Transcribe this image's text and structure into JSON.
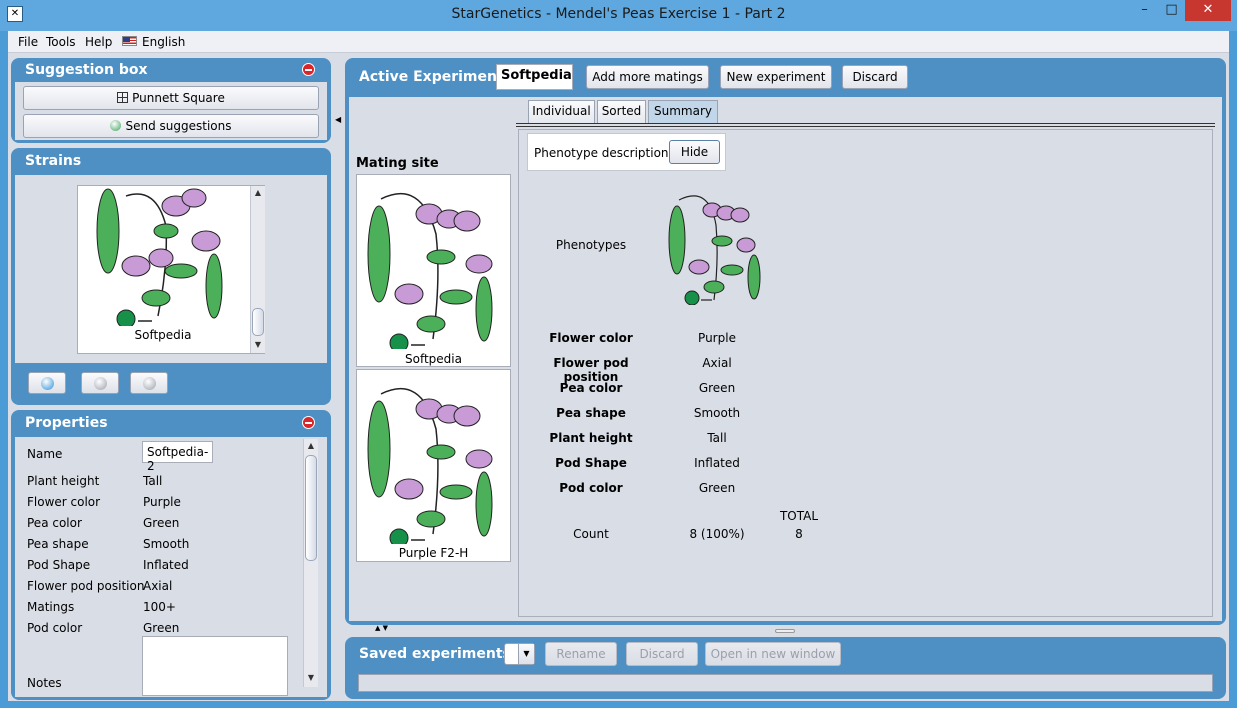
{
  "window": {
    "title": "StarGenetics - Mendel's Peas Exercise 1 - Part 2",
    "minimize_glyph": "–",
    "maximize_glyph": "□",
    "close_glyph": "✕"
  },
  "menu": {
    "file": "File",
    "tools": "Tools",
    "help": "Help",
    "language": "English"
  },
  "suggestion_box": {
    "title": "Suggestion box",
    "punnett_label": "Punnett Square",
    "send_label": "Send suggestions"
  },
  "strains": {
    "title": "Strains",
    "strain_caption": "Softpedia"
  },
  "properties": {
    "title": "Properties",
    "name_label": "Name",
    "name_value": "Softpedia-2",
    "rows": [
      {
        "label": "Plant height",
        "value": "Tall"
      },
      {
        "label": "Flower color",
        "value": "Purple"
      },
      {
        "label": "Pea color",
        "value": "Green"
      },
      {
        "label": "Pea shape",
        "value": "Smooth"
      },
      {
        "label": "Pod Shape",
        "value": "Inflated"
      },
      {
        "label": "Flower pod position",
        "value": "Axial"
      },
      {
        "label": "Matings",
        "value": "100+"
      },
      {
        "label": "Pod color",
        "value": "Green"
      }
    ],
    "notes_label": "Notes"
  },
  "active_experiment": {
    "title": "Active Experiment",
    "name_value": "Softpedia",
    "add_more_label": "Add more matings",
    "new_experiment_label": "New experiment",
    "discard_label": "Discard",
    "mating_site_label": "Mating site",
    "parent1_caption": "Softpedia",
    "parent2_caption": "Purple F2-H",
    "tabs": [
      "Individual",
      "Sorted",
      "Summary"
    ],
    "selected_tab": "Summary",
    "phenotype_description_label": "Phenotype description:",
    "hide_label": "Hide",
    "phenotypes_label": "Phenotypes",
    "traits": [
      {
        "name": "Flower color",
        "value": "Purple"
      },
      {
        "name": "Flower pod position",
        "value": "Axial"
      },
      {
        "name": "Pea color",
        "value": "Green"
      },
      {
        "name": "Pea shape",
        "value": "Smooth"
      },
      {
        "name": "Plant height",
        "value": "Tall"
      },
      {
        "name": "Pod Shape",
        "value": "Inflated"
      },
      {
        "name": "Pod color",
        "value": "Green"
      }
    ],
    "total_label": "TOTAL",
    "count_label": "Count",
    "count_value": "8 (100%)",
    "total_value": "8"
  },
  "saved_experiments": {
    "title": "Saved experiments",
    "rename_label": "Rename",
    "discard_label": "Discard",
    "open_label": "Open in new window"
  },
  "colors": {
    "panel_blue": "#4e90c4",
    "pod_green": "#4cb05a",
    "flower_purple": "#c89bd6",
    "pea_green": "#17904a"
  }
}
